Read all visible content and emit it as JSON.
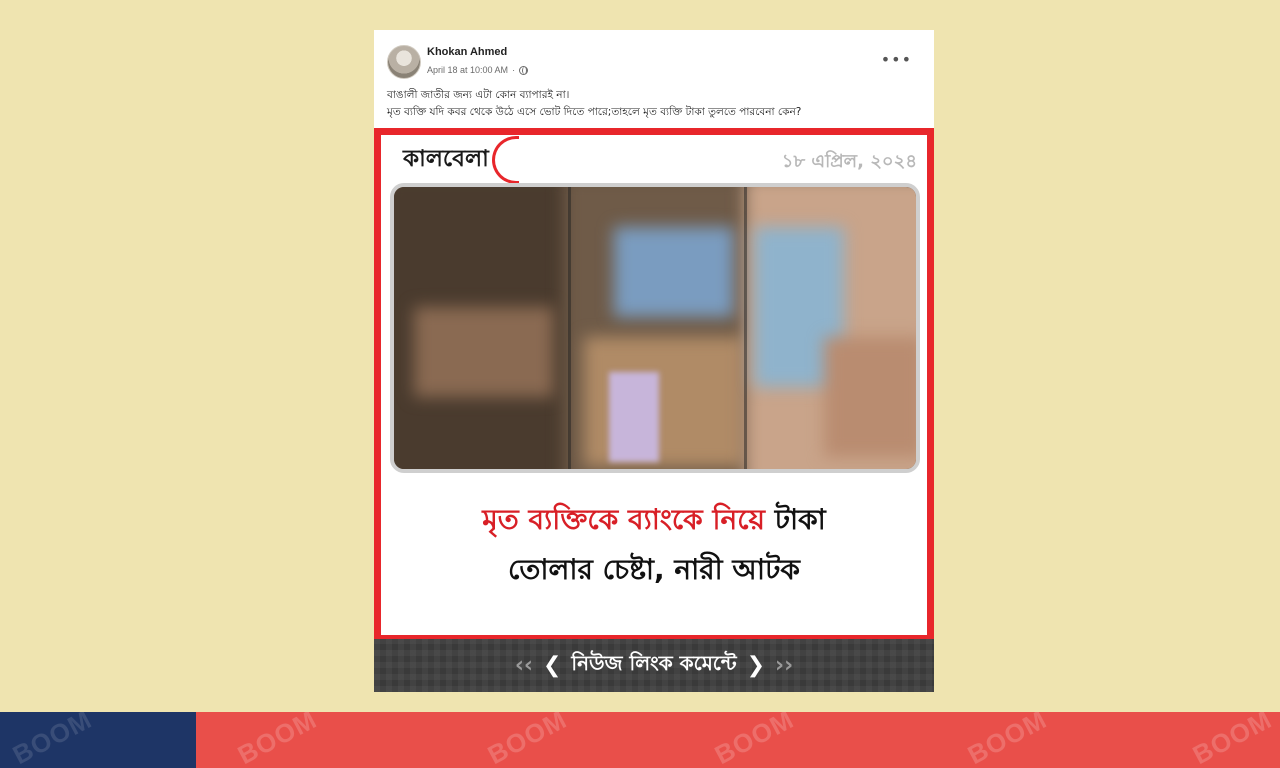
{
  "post": {
    "author": "Khokan Ahmed",
    "timestamp": "April 18 at 10:00 AM",
    "more_label": "•••",
    "caption_lines": [
      "বাঙালী জাতীর জন্য এটা কোন ব্যাপারই না।",
      "মৃত ব্যক্তি যদি কবর থেকে উঠে এসে ভোট দিতে পারে;তাহলে মৃত ব্যক্তি টাকা তুলতে পারবেনা কেন?"
    ],
    "icons": {
      "privacy": "globe-icon",
      "menu": "more-options-icon"
    }
  },
  "news_card": {
    "logo_text": "কালবেলা",
    "date": "১৮ এপ্রিল, ২০২৪",
    "headline_red": "মৃত ব্যক্তিকে ব্যাংকে নিয়ে",
    "headline_black_1": "টাকা",
    "headline_black_2": "তোলার চেষ্টা, নারী আটক",
    "banner_text": "নিউজ লিংক কমেন্টে",
    "colors": {
      "frame": "#e8262b",
      "headline_accent": "#d81f26",
      "banner_bg": "#3a3a3a"
    }
  },
  "footer": {
    "watermark": "BOOM",
    "colors": {
      "left": "#1e3566",
      "right": "#e94f4a",
      "background": "#efe4b0"
    }
  }
}
